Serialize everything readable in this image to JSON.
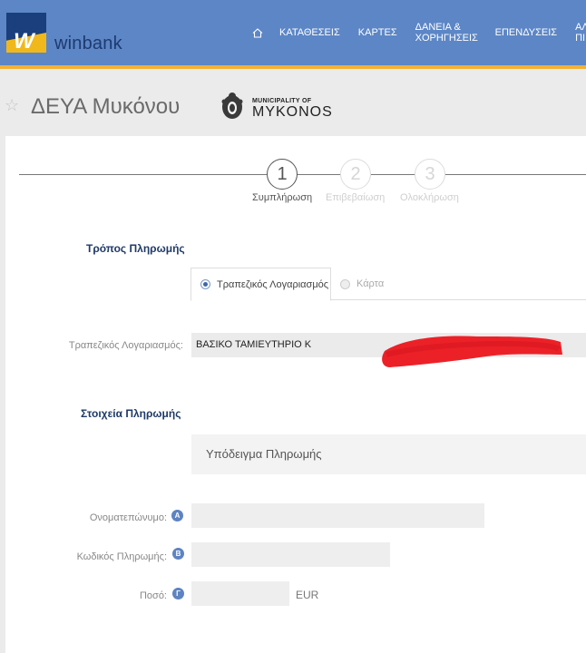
{
  "brand": {
    "name": "winbank",
    "logo_letter": "W",
    "colors": {
      "header": "#5c86c6",
      "accent": "#f2b134",
      "logo_dark": "#1a3f7c"
    }
  },
  "nav": {
    "home_icon": "home-icon",
    "items": [
      {
        "label": "ΚΑΤΑΘΕΣΕΙΣ"
      },
      {
        "label": "ΚΑΡΤΕΣ"
      },
      {
        "label_line1": "ΔΑΝΕΙΑ &",
        "label_line2": "ΧΟΡΗΓΗΣΕΙΣ"
      },
      {
        "label": "ΕΠΕΝΔΥΣΕΙΣ"
      },
      {
        "label_line1": "ΑΛ",
        "label_line2": "ΠΙ"
      }
    ]
  },
  "page": {
    "favorite_icon": "star-icon",
    "title": "ΔΕΥΑ Μυκόνου",
    "municipality_small": "MUNICIPALITY OF",
    "municipality_big": "MYKONOS"
  },
  "stepper": {
    "steps": [
      {
        "number": "1",
        "label": "Συμπλήρωση",
        "active": true
      },
      {
        "number": "2",
        "label": "Επιβεβαίωση",
        "active": false
      },
      {
        "number": "3",
        "label": "Ολοκλήρωση",
        "active": false
      }
    ]
  },
  "payment_method": {
    "section_title": "Τρόπος Πληρωμής",
    "tabs": [
      {
        "label": "Τραπεζικός Λογαριασμός",
        "selected": true
      },
      {
        "label": "Κάρτα",
        "selected": false
      }
    ],
    "account_label": "Τραπεζικός Λογαριασμός:",
    "account_value": "ΒΑΣΙΚΟ ΤΑΜΙΕΥΤΗΡΙΟ Κ"
  },
  "payment_details": {
    "section_title": "Στοιχεία Πληρωμής",
    "template_label": "Υπόδειγμα Πληρωμής",
    "fields": [
      {
        "label": "Ονοματεπώνυμο:",
        "badge": "Α",
        "value": ""
      },
      {
        "label": "Κωδικός Πληρωμής:",
        "badge": "Β",
        "value": ""
      },
      {
        "label": "Ποσό:",
        "badge": "Γ",
        "value": ""
      }
    ],
    "amount_unit": "EUR"
  }
}
